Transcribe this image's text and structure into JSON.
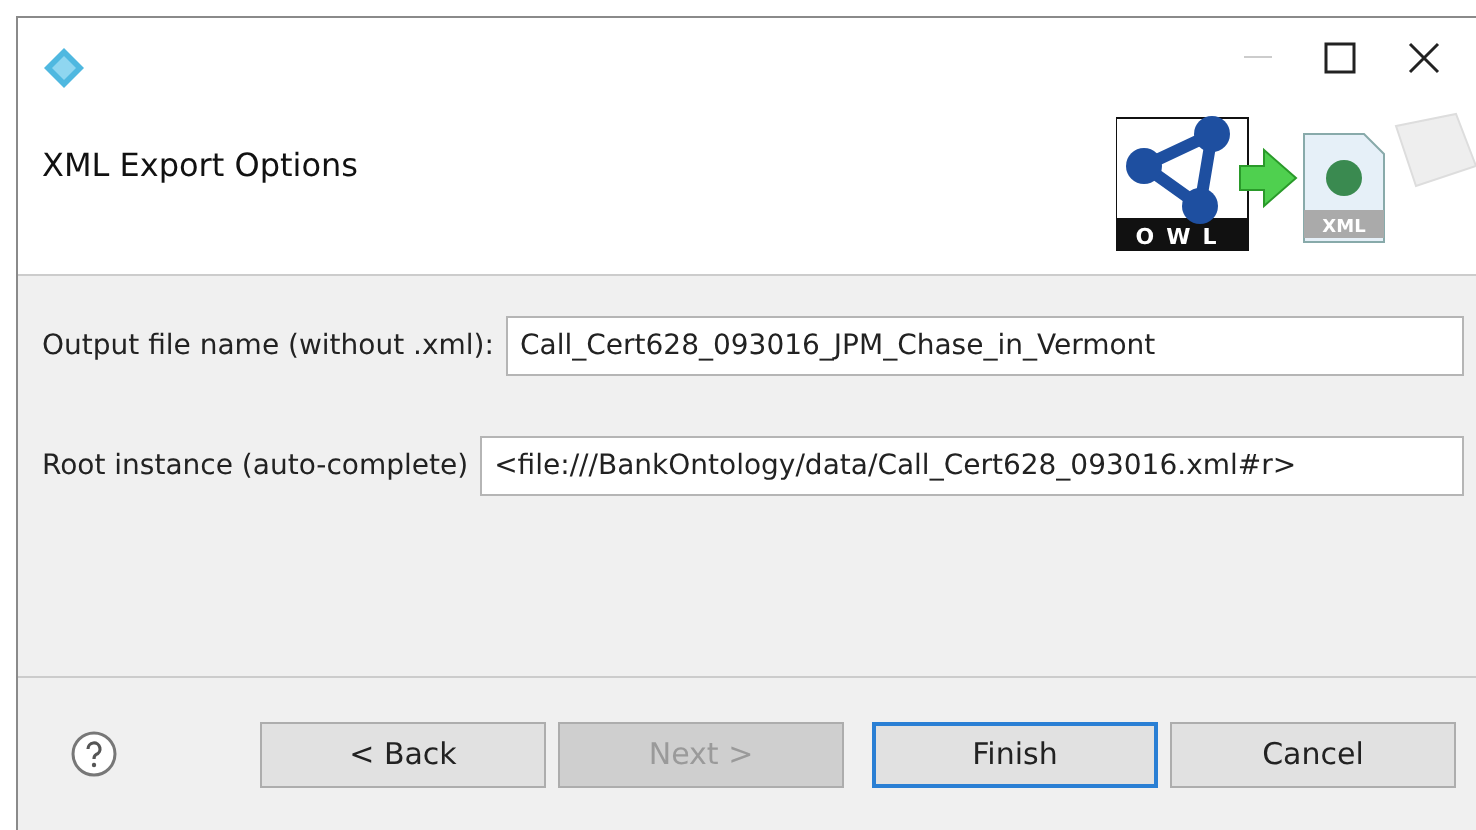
{
  "window": {
    "title": "XML Export Options"
  },
  "fields": [
    {
      "label": "Output file name (without .xml):",
      "value": "Call_Cert628_093016_JPM_Chase_in_Vermont"
    },
    {
      "label": "Root instance (auto-complete)",
      "value": "<file:///BankOntology/data/Call_Cert628_093016.xml#r>"
    }
  ],
  "logo": {
    "caption": "OWL",
    "file_label": "XML"
  },
  "buttons": [
    {
      "label": "< Back",
      "disabled": false,
      "default": false
    },
    {
      "label": "Next >",
      "disabled": true,
      "default": false
    },
    {
      "label": "Finish",
      "disabled": false,
      "default": true
    },
    {
      "label": "Cancel",
      "disabled": false,
      "default": false
    }
  ]
}
